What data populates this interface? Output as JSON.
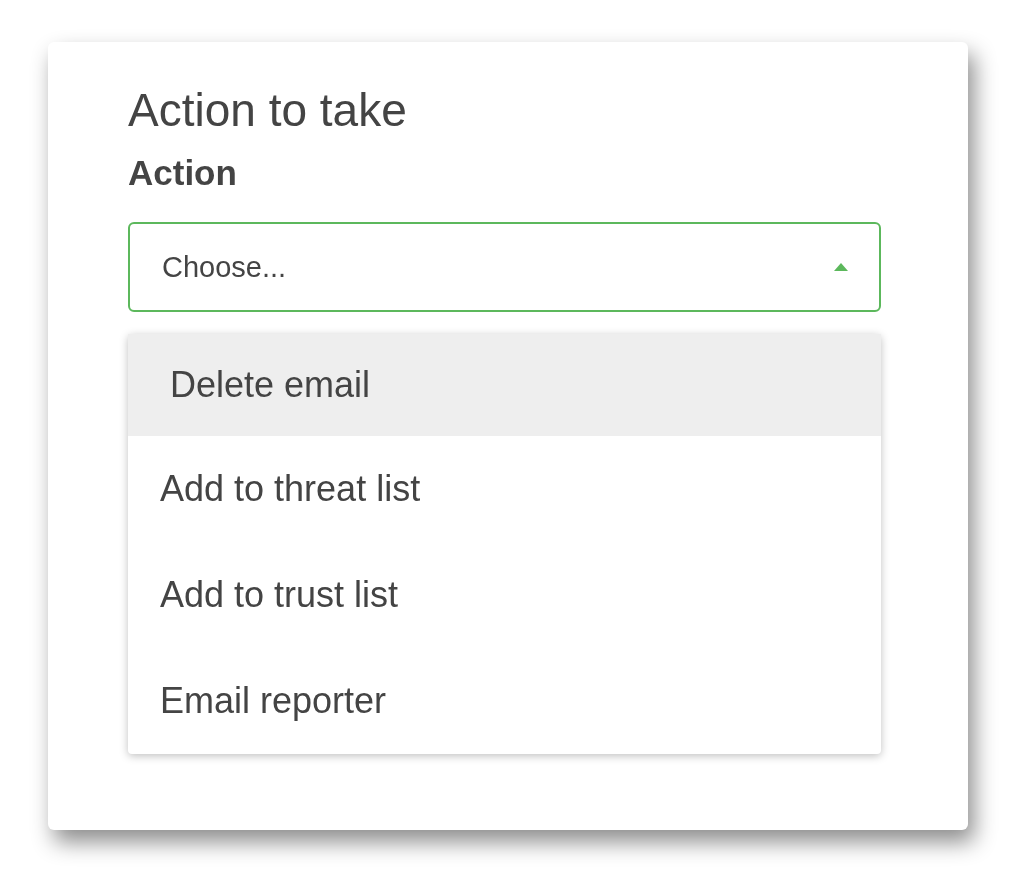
{
  "card": {
    "title": "Action to take",
    "field_label": "Action",
    "select": {
      "placeholder": "Choose...",
      "expanded": true
    },
    "options": [
      {
        "label": "Delete email",
        "selected": true
      },
      {
        "label": "Add to threat list",
        "selected": false
      },
      {
        "label": "Add to trust list",
        "selected": false
      },
      {
        "label": "Email reporter",
        "selected": false
      }
    ]
  }
}
